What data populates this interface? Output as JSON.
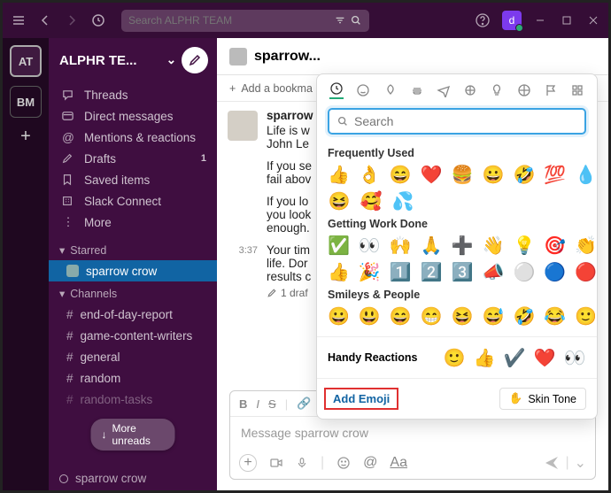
{
  "titlebar": {
    "search_placeholder": "Search ALPHR TEAM",
    "user_initial": "d"
  },
  "rail": {
    "workspaces": [
      "AT",
      "BM"
    ]
  },
  "sidebar": {
    "workspace_name": "ALPHR TE...",
    "nav": [
      {
        "icon": "threads",
        "label": "Threads"
      },
      {
        "icon": "dm",
        "label": "Direct messages"
      },
      {
        "icon": "mentions",
        "label": "Mentions & reactions"
      },
      {
        "icon": "drafts",
        "label": "Drafts",
        "count": "1"
      },
      {
        "icon": "saved",
        "label": "Saved items"
      },
      {
        "icon": "connect",
        "label": "Slack Connect"
      },
      {
        "icon": "more",
        "label": "More"
      }
    ],
    "starred_label": "Starred",
    "starred": [
      {
        "label": "sparrow crow"
      }
    ],
    "channels_label": "Channels",
    "channels": [
      {
        "label": "end-of-day-report"
      },
      {
        "label": "game-content-writers"
      },
      {
        "label": "general"
      },
      {
        "label": "random"
      },
      {
        "label": "random-tasks"
      }
    ],
    "more_unreads": "More unreads",
    "dm_bottom": "sparrow crow"
  },
  "channel": {
    "name": "sparrow...",
    "bookmark": "Add a bookma"
  },
  "messages": {
    "author": "sparrow",
    "line1": "Life is w",
    "line2": "John Le",
    "para2a": "If you se",
    "para2b": "fail abov",
    "para3a": "If you lo",
    "para3b": "you look",
    "para3c": "enough.",
    "time": "3:37",
    "para4a": "Your tim",
    "para4b": "life. Dor",
    "para4c": "results c",
    "draft": "1 draf"
  },
  "composer": {
    "placeholder": "Message sparrow crow"
  },
  "picker": {
    "search_placeholder": "Search",
    "freq_label": "Frequently Used",
    "freq": [
      [
        "👍",
        "👌",
        "😄",
        "❤️",
        "🍔",
        "😀",
        "🤣",
        "💯",
        "💧"
      ],
      [
        "😆",
        "🥰",
        "💦"
      ]
    ],
    "work_label": "Getting Work Done",
    "work": [
      [
        "✅",
        "👀",
        "🙌",
        "🙏",
        "➕",
        "👋",
        "💡",
        "🎯",
        "👏"
      ],
      [
        "👍",
        "🎉",
        "1️⃣",
        "2️⃣",
        "3️⃣",
        "📣",
        "⚪",
        "🔵",
        "🔴"
      ]
    ],
    "smileys_label": "Smileys & People",
    "smileys": [
      [
        "😀",
        "😃",
        "😄",
        "😁",
        "😆",
        "😅",
        "🤣",
        "😂",
        "🙂"
      ]
    ],
    "handy_label": "Handy Reactions",
    "handy": [
      "🙂",
      "👍",
      "✔️",
      "❤️",
      "👀"
    ],
    "add_emoji": "Add Emoji",
    "skin_tone": "Skin Tone",
    "skin_emoji": "✋"
  }
}
